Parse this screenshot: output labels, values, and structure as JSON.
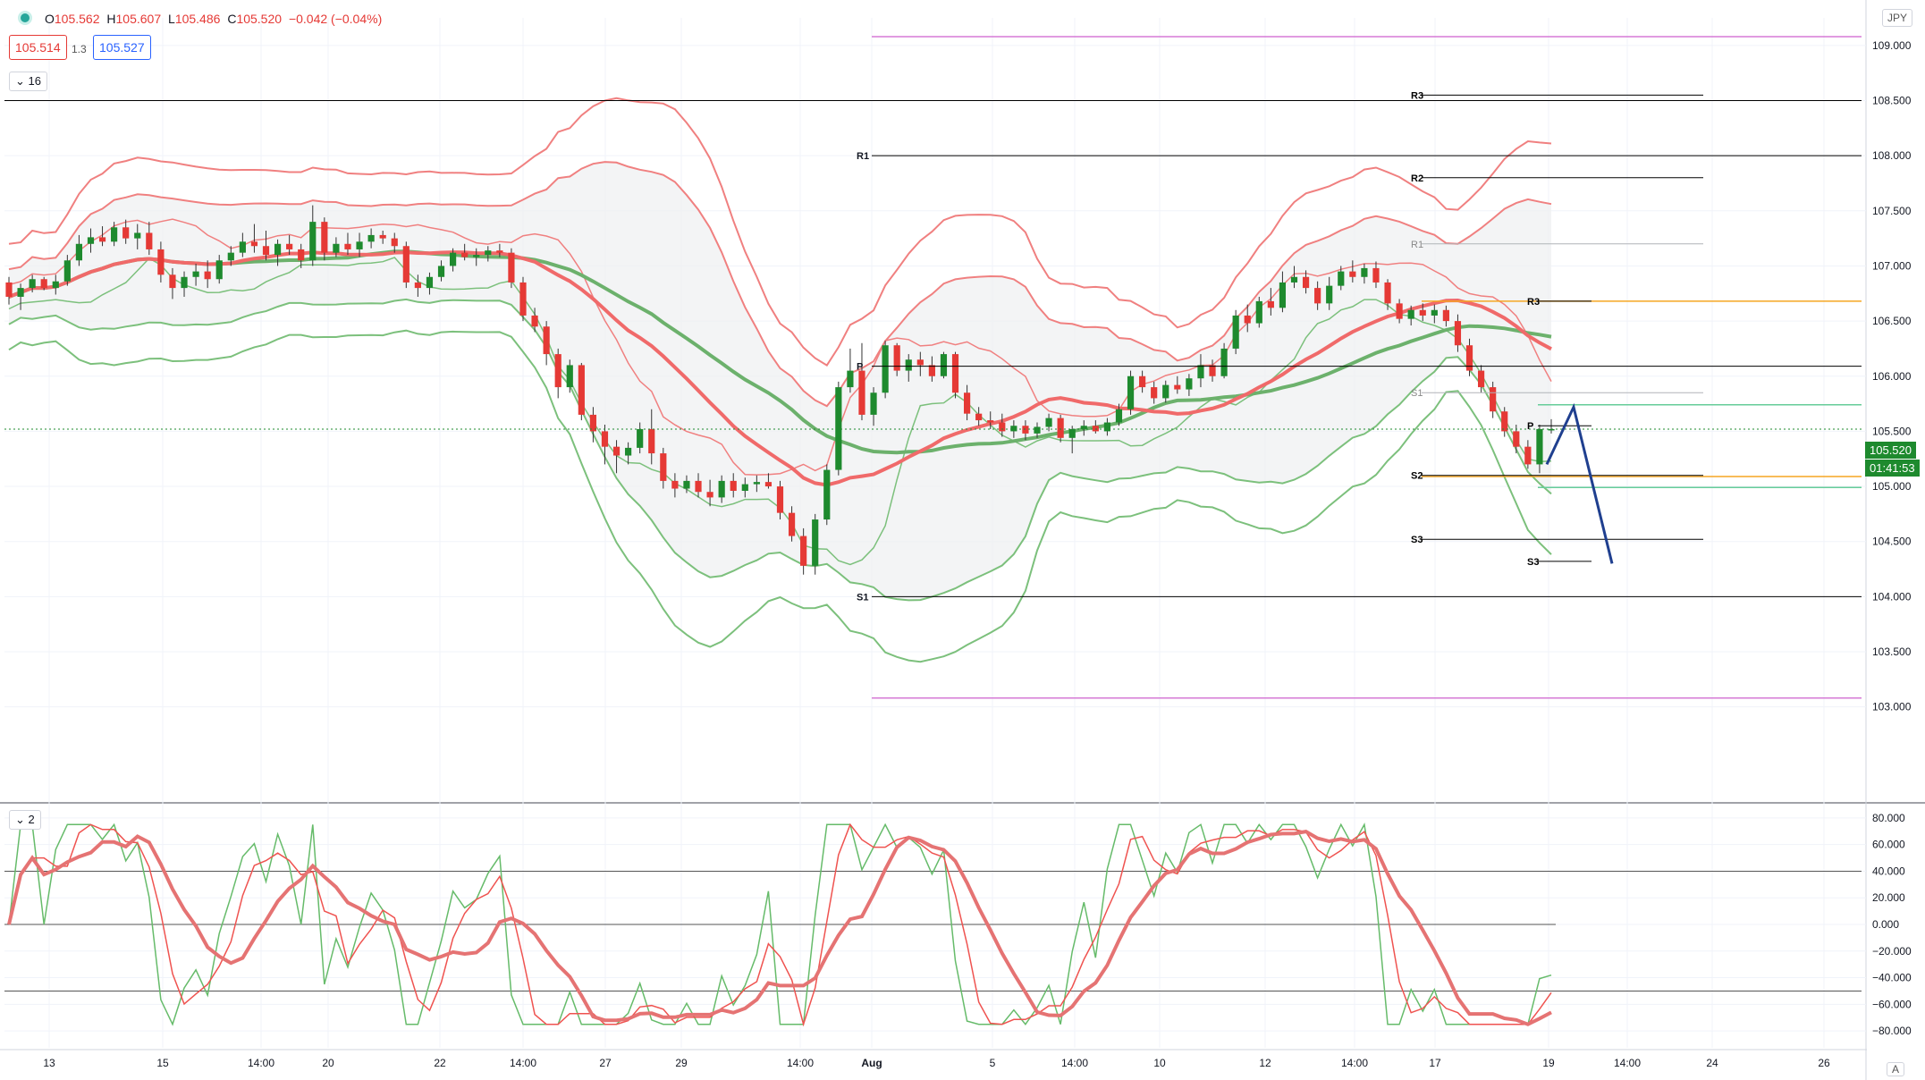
{
  "header": {
    "open_label": "O",
    "open": "105.562",
    "high_label": "H",
    "high": "105.607",
    "low_label": "L",
    "low": "105.486",
    "close_label": "C",
    "close": "105.520",
    "change": "−0.042 (−0.04%)",
    "bid": "105.514",
    "spread": "1.3",
    "ask": "105.527",
    "main_indicator_count": "16",
    "osc_indicator_count": "2",
    "currency": "JPY",
    "last_price": "105.520",
    "countdown": "01:41:53",
    "auto_label": "A"
  },
  "colors": {
    "up": "#1e8a2e",
    "down": "#e53935",
    "band_red": "#f08080",
    "band_green": "#7cc07c",
    "mid_red": "#f06a6a",
    "mid_green": "#6cb16c",
    "pivot_line": "#000000",
    "magenta": "#d57ad5",
    "orange": "#f5a623",
    "teal": "#66cc99",
    "forecast": "#1f3f8f"
  },
  "chart_data": [
    {
      "type": "candlestick",
      "title": "",
      "ylabel": "",
      "ylim": [
        102.6,
        109.25
      ],
      "y_ticks": [
        "109.000",
        "108.500",
        "108.000",
        "107.500",
        "107.000",
        "106.500",
        "106.000",
        "105.500",
        "105.000",
        "104.500",
        "104.000",
        "103.500",
        "103.000"
      ],
      "x_ticks": [
        "13",
        "15",
        "14:00",
        "20",
        "22",
        "14:00",
        "27",
        "29",
        "14:00",
        "Aug",
        "5",
        "14:00",
        "10",
        "12",
        "14:00",
        "17",
        "19",
        "14:00",
        "24",
        "26"
      ],
      "candles_ohlc": [
        [
          106.85,
          106.9,
          106.65,
          106.72
        ],
        [
          106.72,
          106.84,
          106.6,
          106.8
        ],
        [
          106.8,
          106.92,
          106.76,
          106.88
        ],
        [
          106.88,
          106.9,
          106.78,
          106.8
        ],
        [
          106.8,
          106.92,
          106.74,
          106.86
        ],
        [
          106.86,
          107.1,
          106.82,
          107.05
        ],
        [
          107.05,
          107.28,
          107.0,
          107.2
        ],
        [
          107.2,
          107.34,
          107.12,
          107.26
        ],
        [
          107.26,
          107.36,
          107.18,
          107.22
        ],
        [
          107.22,
          107.4,
          107.18,
          107.35
        ],
        [
          107.35,
          107.42,
          107.2,
          107.25
        ],
        [
          107.25,
          107.38,
          107.15,
          107.3
        ],
        [
          107.3,
          107.4,
          107.1,
          107.15
        ],
        [
          107.15,
          107.22,
          106.85,
          106.92
        ],
        [
          106.92,
          106.98,
          106.7,
          106.8
        ],
        [
          106.8,
          106.95,
          106.72,
          106.9
        ],
        [
          106.9,
          107.02,
          106.82,
          106.95
        ],
        [
          106.95,
          107.05,
          106.8,
          106.88
        ],
        [
          106.88,
          107.1,
          106.84,
          107.05
        ],
        [
          107.05,
          107.18,
          107.0,
          107.12
        ],
        [
          107.12,
          107.3,
          107.08,
          107.22
        ],
        [
          107.22,
          107.38,
          107.12,
          107.18
        ],
        [
          107.18,
          107.32,
          107.05,
          107.1
        ],
        [
          107.1,
          107.24,
          107.0,
          107.2
        ],
        [
          107.2,
          107.28,
          107.1,
          107.15
        ],
        [
          107.15,
          107.2,
          106.98,
          107.05
        ],
        [
          107.05,
          107.55,
          107.0,
          107.4
        ],
        [
          107.4,
          107.44,
          107.05,
          107.12
        ],
        [
          107.12,
          107.26,
          107.08,
          107.2
        ],
        [
          107.2,
          107.3,
          107.1,
          107.15
        ],
        [
          107.15,
          107.3,
          107.08,
          107.22
        ],
        [
          107.22,
          107.34,
          107.16,
          107.28
        ],
        [
          107.28,
          107.32,
          107.2,
          107.25
        ],
        [
          107.25,
          107.3,
          107.12,
          107.18
        ],
        [
          107.18,
          107.22,
          106.8,
          106.85
        ],
        [
          106.85,
          106.92,
          106.72,
          106.8
        ],
        [
          106.8,
          106.94,
          106.74,
          106.9
        ],
        [
          106.9,
          107.05,
          106.86,
          107.0
        ],
        [
          107.0,
          107.16,
          106.95,
          107.12
        ],
        [
          107.12,
          107.2,
          107.05,
          107.08
        ],
        [
          107.08,
          107.16,
          107.0,
          107.1
        ],
        [
          107.1,
          107.18,
          107.04,
          107.14
        ],
        [
          107.14,
          107.2,
          107.08,
          107.12
        ],
        [
          107.12,
          107.16,
          106.8,
          106.85
        ],
        [
          106.85,
          106.9,
          106.5,
          106.55
        ],
        [
          106.55,
          106.62,
          106.4,
          106.45
        ],
        [
          106.45,
          106.5,
          106.1,
          106.2
        ],
        [
          106.2,
          106.25,
          105.8,
          105.9
        ],
        [
          105.9,
          106.15,
          105.85,
          106.1
        ],
        [
          106.1,
          106.12,
          105.6,
          105.65
        ],
        [
          105.65,
          105.72,
          105.4,
          105.5
        ],
        [
          105.5,
          105.56,
          105.2,
          105.36
        ],
        [
          105.36,
          105.42,
          105.12,
          105.28
        ],
        [
          105.28,
          105.4,
          105.2,
          105.35
        ],
        [
          105.35,
          105.58,
          105.3,
          105.52
        ],
        [
          105.52,
          105.7,
          105.2,
          105.3
        ],
        [
          105.3,
          105.35,
          104.98,
          105.05
        ],
        [
          105.05,
          105.12,
          104.9,
          104.98
        ],
        [
          104.98,
          105.1,
          104.94,
          105.05
        ],
        [
          105.05,
          105.12,
          104.9,
          104.95
        ],
        [
          104.95,
          105.06,
          104.82,
          104.9
        ],
        [
          104.9,
          105.1,
          104.85,
          105.05
        ],
        [
          105.05,
          105.12,
          104.9,
          104.96
        ],
        [
          104.96,
          105.08,
          104.9,
          105.02
        ],
        [
          105.02,
          105.1,
          104.95,
          105.04
        ],
        [
          105.04,
          105.12,
          104.98,
          105.0
        ],
        [
          105.0,
          105.05,
          104.7,
          104.76
        ],
        [
          104.76,
          104.82,
          104.5,
          104.55
        ],
        [
          104.55,
          104.62,
          104.2,
          104.28
        ],
        [
          104.28,
          104.75,
          104.2,
          104.7
        ],
        [
          104.7,
          105.2,
          104.65,
          105.15
        ],
        [
          105.15,
          105.95,
          105.1,
          105.9
        ],
        [
          105.9,
          106.25,
          105.85,
          106.05
        ],
        [
          106.05,
          106.3,
          105.6,
          105.65
        ],
        [
          105.65,
          105.9,
          105.55,
          105.85
        ],
        [
          105.85,
          106.32,
          105.8,
          106.28
        ],
        [
          106.28,
          106.3,
          106.0,
          106.05
        ],
        [
          106.05,
          106.2,
          105.95,
          106.15
        ],
        [
          106.15,
          106.22,
          106.0,
          106.1
        ],
        [
          106.1,
          106.18,
          105.95,
          106.0
        ],
        [
          106.0,
          106.22,
          105.98,
          106.2
        ],
        [
          106.2,
          106.22,
          105.8,
          105.85
        ],
        [
          105.85,
          105.92,
          105.6,
          105.66
        ],
        [
          105.66,
          105.72,
          105.55,
          105.6
        ],
        [
          105.6,
          105.68,
          105.52,
          105.58
        ],
        [
          105.58,
          105.66,
          105.45,
          105.5
        ],
        [
          105.5,
          105.6,
          105.44,
          105.55
        ],
        [
          105.55,
          105.6,
          105.42,
          105.48
        ],
        [
          105.48,
          105.58,
          105.44,
          105.54
        ],
        [
          105.54,
          105.66,
          105.5,
          105.62
        ],
        [
          105.62,
          105.65,
          105.4,
          105.44
        ],
        [
          105.44,
          105.55,
          105.3,
          105.52
        ],
        [
          105.52,
          105.6,
          105.46,
          105.55
        ],
        [
          105.55,
          105.6,
          105.48,
          105.5
        ],
        [
          105.5,
          105.62,
          105.46,
          105.58
        ],
        [
          105.58,
          105.75,
          105.55,
          105.7
        ],
        [
          105.7,
          106.05,
          105.65,
          106.0
        ],
        [
          106.0,
          106.05,
          105.85,
          105.9
        ],
        [
          105.9,
          105.95,
          105.75,
          105.8
        ],
        [
          105.8,
          105.96,
          105.76,
          105.92
        ],
        [
          105.92,
          106.0,
          105.84,
          105.88
        ],
        [
          105.88,
          106.02,
          105.82,
          105.98
        ],
        [
          105.98,
          106.2,
          105.9,
          106.1
        ],
        [
          106.1,
          106.15,
          105.95,
          106.0
        ],
        [
          106.0,
          106.3,
          105.98,
          106.25
        ],
        [
          106.25,
          106.6,
          106.2,
          106.55
        ],
        [
          106.55,
          106.65,
          106.4,
          106.48
        ],
        [
          106.48,
          106.72,
          106.44,
          106.68
        ],
        [
          106.68,
          106.8,
          106.55,
          106.62
        ],
        [
          106.62,
          106.95,
          106.58,
          106.85
        ],
        [
          106.85,
          107.0,
          106.8,
          106.9
        ],
        [
          106.9,
          106.96,
          106.75,
          106.8
        ],
        [
          106.8,
          106.86,
          106.6,
          106.66
        ],
        [
          106.66,
          106.9,
          106.6,
          106.82
        ],
        [
          106.82,
          107.0,
          106.78,
          106.95
        ],
        [
          106.95,
          107.05,
          106.85,
          106.9
        ],
        [
          106.9,
          107.02,
          106.84,
          106.98
        ],
        [
          106.98,
          107.04,
          106.8,
          106.85
        ],
        [
          106.85,
          106.88,
          106.6,
          106.66
        ],
        [
          106.66,
          106.7,
          106.48,
          106.52
        ],
        [
          106.52,
          106.64,
          106.46,
          106.6
        ],
        [
          106.6,
          106.66,
          106.5,
          106.55
        ],
        [
          106.55,
          106.65,
          106.48,
          106.6
        ],
        [
          106.6,
          106.64,
          106.45,
          106.5
        ],
        [
          106.5,
          106.56,
          106.22,
          106.28
        ],
        [
          106.28,
          106.34,
          106.0,
          106.05
        ],
        [
          106.05,
          106.1,
          105.85,
          105.9
        ],
        [
          105.9,
          105.95,
          105.62,
          105.68
        ],
        [
          105.68,
          105.72,
          105.45,
          105.5
        ],
        [
          105.5,
          105.56,
          105.3,
          105.36
        ],
        [
          105.36,
          105.42,
          105.16,
          105.2
        ],
        [
          105.2,
          105.56,
          105.12,
          105.52
        ],
        [
          105.52,
          105.61,
          105.48,
          105.52
        ]
      ],
      "bollinger_red": {
        "upper_outer": "price band upper",
        "mid": "thick red"
      },
      "pivot_lines_left": [
        {
          "label": "R1",
          "value": 108.0
        },
        {
          "label": "P",
          "value": 106.09
        },
        {
          "label": "S1",
          "value": 104.0
        }
      ],
      "pivot_lines_right": [
        {
          "label": "R3",
          "value": 108.55
        },
        {
          "label": "R2",
          "value": 107.8
        },
        {
          "label": "R1",
          "value": 107.2
        },
        {
          "label": "R3",
          "value": 106.68
        },
        {
          "label": "S1",
          "value": 105.85
        },
        {
          "label": "P",
          "value": 105.55
        },
        {
          "label": "S2",
          "value": 105.1
        },
        {
          "label": "S3",
          "value": 104.52
        },
        {
          "label": "S3",
          "value": 104.32
        }
      ],
      "horizontal_levels": {
        "top_magenta": 109.08,
        "bottom_magenta": 103.08,
        "top_black": 108.5,
        "orange_upper": 106.68,
        "orange_lower": 105.09,
        "teal_upper": 105.74,
        "teal_lower": 104.99,
        "last_price_dotted": 105.52
      },
      "forecast_path": [
        [
          105.2,
          0
        ],
        [
          105.72,
          1
        ],
        [
          104.3,
          2
        ]
      ]
    },
    {
      "type": "line",
      "title": "",
      "ylim": [
        -90,
        90
      ],
      "y_ticks": [
        "80.000",
        "60.000",
        "40.000",
        "20.000",
        "0.000",
        "−20.000",
        "−40.000",
        "−60.000",
        "−80.000"
      ],
      "levels": [
        40,
        0,
        -50
      ]
    }
  ]
}
